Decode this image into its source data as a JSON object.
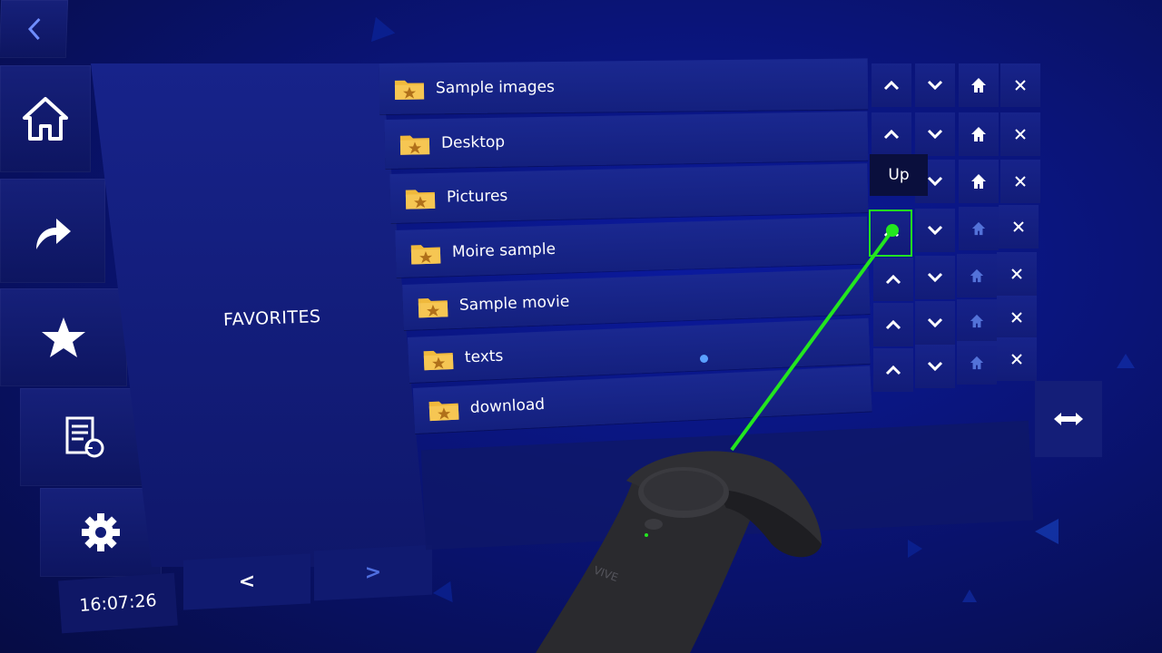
{
  "sidebar": {
    "items": [
      {
        "name": "back-icon"
      },
      {
        "name": "home-icon"
      },
      {
        "name": "share-icon"
      },
      {
        "name": "star-icon"
      },
      {
        "name": "history-icon"
      },
      {
        "name": "gear-icon"
      }
    ],
    "clock": "16:07:26"
  },
  "favorites": {
    "label": "FAVORITES",
    "prev_label": "<",
    "next_label": ">"
  },
  "folders": [
    {
      "name": "Sample images"
    },
    {
      "name": "Desktop"
    },
    {
      "name": "Pictures"
    },
    {
      "name": "Moire sample"
    },
    {
      "name": "Sample movie"
    },
    {
      "name": "texts"
    },
    {
      "name": "download"
    }
  ],
  "actions": {
    "up_icon": "chevron-up-icon",
    "down_icon": "chevron-down-icon",
    "home_icon": "home-icon",
    "remove_icon": "close-icon"
  },
  "tooltip": {
    "text": "Up"
  },
  "colors": {
    "background": "#0a1477",
    "panel": "#17238a",
    "laser": "#23e61f",
    "folder": "#f0b93c",
    "folder_star": "#b0701a",
    "accent_dim": "#5a7ae0"
  }
}
